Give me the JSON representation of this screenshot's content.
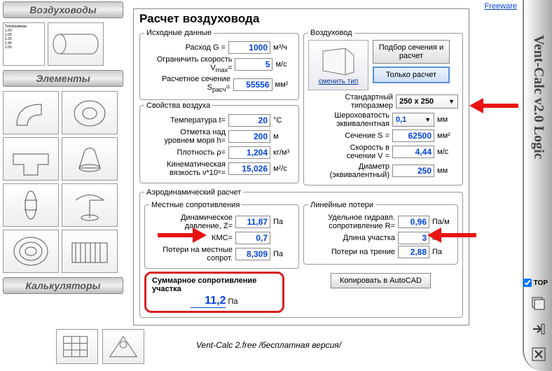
{
  "freeware": "Freeware",
  "rail_title": "Vent-Calc v2.0 Logic",
  "top_label": "TOP",
  "left": {
    "section1": "Воздуховоды",
    "section2": "Элементы",
    "section3": "Калькуляторы"
  },
  "version_text": "Vent-Calc 2.free /бесплатная версия/",
  "main_title": "Расчет воздуховода",
  "source": {
    "legend": "Исходные данные",
    "flow_label": "Расход G =",
    "flow_value": "1000",
    "flow_unit": "м³/ч",
    "vmax_label": "Ограничить скорость V",
    "vmax_sub": "max",
    "vmax_eq": "=",
    "vmax_value": "5",
    "vmax_unit": "м/с",
    "section_label": "Расчетное сечение S",
    "section_sub": "расч",
    "section_eq": "=",
    "section_value": "55556",
    "section_unit": "мм²"
  },
  "air": {
    "legend": "Свойства воздуха",
    "temp_label": "Температура t=",
    "temp_value": "20",
    "temp_unit": "°C",
    "alt_label": "Отметка над уровнем моря h=",
    "alt_value": "200",
    "alt_unit": "м",
    "dens_label": "Плотность ρ=",
    "dens_value": "1,204",
    "dens_unit": "кг/м³",
    "visc_label": "Кинематическая вязкость ν*10⁶=",
    "visc_value": "15,026",
    "visc_unit": "м²/с"
  },
  "duct": {
    "legend": "Воздуховод",
    "change_type": "сменить тип",
    "btn_pick": "Подбор сечения и расчет",
    "btn_calc": "Только расчет",
    "size_label": "Стандартный типоразмер",
    "size_value": "250 x 250",
    "rough_label": "Шероховатость эквивалентная",
    "rough_value": "0,1",
    "rough_unit": "мм",
    "S_label": "Сечение S =",
    "S_value": "62500",
    "S_unit": "мм²",
    "V_label": "Скорость в сечении V =",
    "V_value": "4,44",
    "V_unit": "м/с",
    "D_label": "Диаметр (эквивалентный)",
    "D_value": "250",
    "D_unit": "мм"
  },
  "aero": {
    "legend": "Аэродинамический расчет",
    "local_legend": "Местные сопротивления",
    "dyn_label": "Динамическое давление, Z=",
    "dyn_value": "11,87",
    "dyn_unit": "Па",
    "kmc_label": "КМС=",
    "kmc_value": "0,7",
    "loss_label": "Потери на местные сопрот.",
    "loss_value": "8,309",
    "loss_unit": "Па",
    "line_legend": "Линейные потери",
    "R_label": "Удельное гидравл. сопротивление R=",
    "R_value": "0,96",
    "R_unit": "Па/м",
    "L_label": "Длина участка",
    "L_value": "3",
    "L_unit": "м",
    "fric_label": "Потери на трение",
    "fric_value": "2,88",
    "fric_unit": "Па",
    "total_label": "Суммарное сопротивление участка",
    "total_value": "11,2",
    "total_unit": "Па",
    "copy_btn": "Копировать в AutoCAD"
  }
}
